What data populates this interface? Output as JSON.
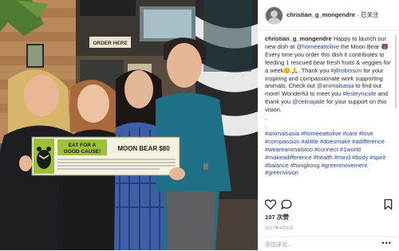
{
  "post": {
    "username": "christian_g_mongendre",
    "separator": "·",
    "follow_label": "已关注",
    "caption_user": "christian_g_mongendre",
    "caption_1": " Happy to launch our new dish at ",
    "mention_1": "@homeeattolive",
    "caption_2": " the Moon Bear 🐻 Every time you order this dish it contributes to feeding 1 rescued bear fresh fruits & veggies for a week😊🙏. Thank you ",
    "mention_2": "#jillrobinson",
    "caption_3": " for your inspiring and compassionate work supporting animals. Check out ",
    "mention_3": "@animalsasia",
    "caption_4": " to find out more! Wonderful to meet you ",
    "mention_4": "#lesleynicole",
    "caption_5": " and thank you ",
    "mention_5": "@celinajade",
    "caption_6": " for your support on this vision.",
    "dot_1": ".",
    "dot_2": ".",
    "hashtags": "#animalsasia #homeeattolive #care #love #compassion #alittle #doesmake #adifference #weareanimalstoo #connect #1world #makeadifference #health #mind #body #spirit #balance #hongkong #greenmovement #greenvision",
    "likes": "107 次赞",
    "date": "2017年4月6日",
    "add_comment": "添加评论...",
    "more": "•••"
  },
  "photo": {
    "sign_headline_1": "EAT FOR A",
    "sign_headline_2": "GOOD CAUSE!",
    "sign_dish": "MOON BEAR $80",
    "order_sign": "ORDER HERE",
    "colors": {
      "sign_green": "#9ebf3a",
      "sign_paper": "#f4f1df",
      "shirt_teal": "#1f6f86",
      "plaid_blue": "#3d5fa8",
      "wall_wood": "#b8895a"
    }
  },
  "icons": [
    "heart-icon",
    "comment-icon",
    "bookmark-icon",
    "user-avatar"
  ]
}
